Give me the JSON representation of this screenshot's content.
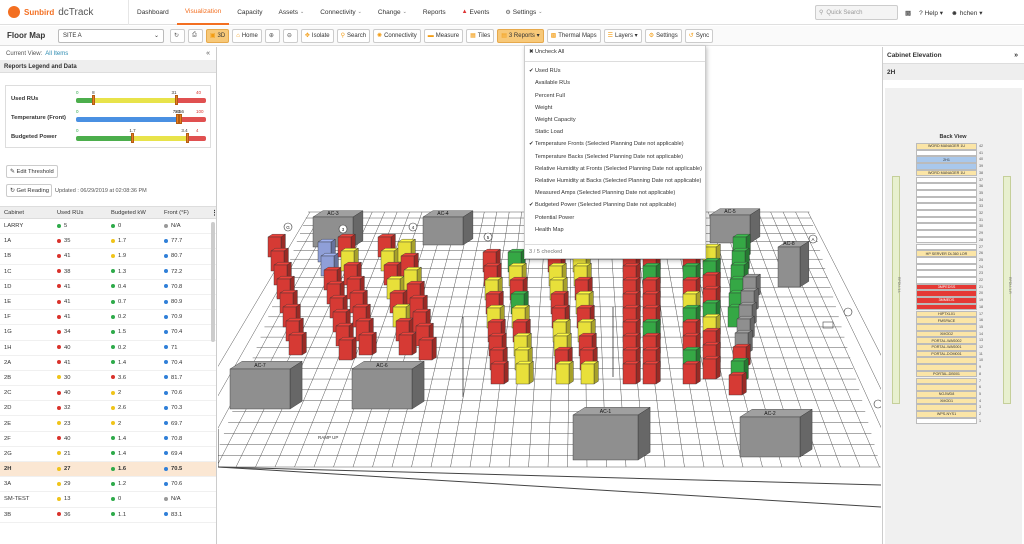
{
  "app": {
    "brand": "Sunbird",
    "product": "dcTrack",
    "nav": [
      {
        "label": "Dashboard",
        "caret": false,
        "active": false
      },
      {
        "label": "Visualization",
        "caret": false,
        "active": true
      },
      {
        "label": "Capacity",
        "caret": false,
        "active": false
      },
      {
        "label": "Assets",
        "caret": true,
        "active": false
      },
      {
        "label": "Connectivity",
        "caret": true,
        "active": false
      },
      {
        "label": "Change",
        "caret": true,
        "active": false
      },
      {
        "label": "Reports",
        "caret": false,
        "active": false
      },
      {
        "label": "Events",
        "caret": false,
        "active": false
      },
      {
        "label": "Settings",
        "caret": true,
        "active": false
      }
    ],
    "quick_search_placeholder": "Quick Search",
    "help_label": "Help",
    "user_label": "hchen"
  },
  "toolbar": {
    "title": "Floor Map",
    "site": "SITE A",
    "buttons": {
      "view3d": "3D",
      "home": "Home",
      "isolate": "Isolate",
      "search": "Search",
      "connectivity": "Connectivity",
      "measure": "Measure",
      "tiles": "Tiles",
      "reports": "3 Reports",
      "thermal": "Thermal Maps",
      "layers": "Layers",
      "settings": "Settings",
      "sync": "Sync"
    }
  },
  "left": {
    "current_view_label": "Current View:",
    "current_view_value": "All Items",
    "legend_title": "Reports Legend and Data",
    "legend": [
      {
        "label": "Used RUs",
        "nums": [
          "0",
          "8",
          "31",
          "40"
        ],
        "thumbs": [
          0.13,
          0.77
        ]
      },
      {
        "label": "Temperature (Front)",
        "nums": [
          "0",
          "72.5",
          "80.6",
          "100"
        ],
        "thumbs": [
          0.78,
          0.8
        ]
      },
      {
        "label": "Budgeted Power",
        "nums": [
          "0",
          "1.7",
          "3.4",
          "4"
        ],
        "thumbs": [
          0.43,
          0.85
        ]
      }
    ],
    "edit_threshold": "Edit Threshold",
    "get_reading": "Get Reading",
    "updated": "Updated : 06/29/2019 at 02:08:36 PM",
    "columns": [
      "Cabinet",
      "Used RUs",
      "Budgeted kW",
      "Front (°F)"
    ],
    "rows": [
      {
        "cab": "LARRY",
        "ru": "5",
        "ruc": "#2eaa4a",
        "kw": "0",
        "kwc": "#2eaa4a",
        "f": "N/A",
        "fc": "#999999",
        "hl": false
      },
      {
        "cab": "1A",
        "ru": "35",
        "ruc": "#d9322b",
        "kw": "1.7",
        "kwc": "#f0c419",
        "f": "77.7",
        "fc": "#2f7fd8",
        "hl": false
      },
      {
        "cab": "1B",
        "ru": "41",
        "ruc": "#d9322b",
        "kw": "1.9",
        "kwc": "#f0c419",
        "f": "80.7",
        "fc": "#2f7fd8",
        "hl": false
      },
      {
        "cab": "1C",
        "ru": "38",
        "ruc": "#d9322b",
        "kw": "1.3",
        "kwc": "#2eaa4a",
        "f": "72.2",
        "fc": "#2f7fd8",
        "hl": false
      },
      {
        "cab": "1D",
        "ru": "41",
        "ruc": "#d9322b",
        "kw": "0.4",
        "kwc": "#2eaa4a",
        "f": "70.8",
        "fc": "#2f7fd8",
        "hl": false
      },
      {
        "cab": "1E",
        "ru": "41",
        "ruc": "#d9322b",
        "kw": "0.7",
        "kwc": "#2eaa4a",
        "f": "80.9",
        "fc": "#2f7fd8",
        "hl": false
      },
      {
        "cab": "1F",
        "ru": "41",
        "ruc": "#d9322b",
        "kw": "0.2",
        "kwc": "#2eaa4a",
        "f": "70.9",
        "fc": "#2f7fd8",
        "hl": false
      },
      {
        "cab": "1G",
        "ru": "34",
        "ruc": "#d9322b",
        "kw": "1.5",
        "kwc": "#2eaa4a",
        "f": "70.4",
        "fc": "#2f7fd8",
        "hl": false
      },
      {
        "cab": "1H",
        "ru": "40",
        "ruc": "#d9322b",
        "kw": "0.2",
        "kwc": "#2eaa4a",
        "f": "71",
        "fc": "#2f7fd8",
        "hl": false
      },
      {
        "cab": "2A",
        "ru": "41",
        "ruc": "#d9322b",
        "kw": "1.4",
        "kwc": "#2eaa4a",
        "f": "70.4",
        "fc": "#2f7fd8",
        "hl": false
      },
      {
        "cab": "2B",
        "ru": "30",
        "ruc": "#f0c419",
        "kw": "3.6",
        "kwc": "#d9322b",
        "f": "81.7",
        "fc": "#2f7fd8",
        "hl": false
      },
      {
        "cab": "2C",
        "ru": "40",
        "ruc": "#d9322b",
        "kw": "2",
        "kwc": "#f0c419",
        "f": "70.6",
        "fc": "#2f7fd8",
        "hl": false
      },
      {
        "cab": "2D",
        "ru": "32",
        "ruc": "#d9322b",
        "kw": "2.6",
        "kwc": "#f0c419",
        "f": "70.3",
        "fc": "#2f7fd8",
        "hl": false
      },
      {
        "cab": "2E",
        "ru": "23",
        "ruc": "#f0c419",
        "kw": "2",
        "kwc": "#f0c419",
        "f": "69.7",
        "fc": "#2f7fd8",
        "hl": false
      },
      {
        "cab": "2F",
        "ru": "40",
        "ruc": "#d9322b",
        "kw": "1.4",
        "kwc": "#2eaa4a",
        "f": "70.8",
        "fc": "#2f7fd8",
        "hl": false
      },
      {
        "cab": "2G",
        "ru": "21",
        "ruc": "#f0c419",
        "kw": "1.4",
        "kwc": "#2eaa4a",
        "f": "69.4",
        "fc": "#2f7fd8",
        "hl": false
      },
      {
        "cab": "2H",
        "ru": "27",
        "ruc": "#f0c419",
        "kw": "1.6",
        "kwc": "#2eaa4a",
        "f": "70.5",
        "fc": "#2f7fd8",
        "hl": true
      },
      {
        "cab": "3A",
        "ru": "29",
        "ruc": "#f0c419",
        "kw": "1.2",
        "kwc": "#2eaa4a",
        "f": "70.6",
        "fc": "#2f7fd8",
        "hl": false
      },
      {
        "cab": "SM-TEST",
        "ru": "13",
        "ruc": "#f0c419",
        "kw": "0",
        "kwc": "#2eaa4a",
        "f": "N/A",
        "fc": "#999999",
        "hl": false
      },
      {
        "cab": "3B",
        "ru": "36",
        "ruc": "#d9322b",
        "kw": "1.1",
        "kwc": "#2eaa4a",
        "f": "83.1",
        "fc": "#2f7fd8",
        "hl": false
      }
    ]
  },
  "dropdown": {
    "uncheck_all": "Uncheck All",
    "items": [
      {
        "label": "Used RUs",
        "checked": true
      },
      {
        "label": "Available RUs",
        "checked": false
      },
      {
        "label": "Percent Full",
        "checked": false
      },
      {
        "label": "Weight",
        "checked": false
      },
      {
        "label": "Weight Capacity",
        "checked": false
      },
      {
        "label": "Static Load",
        "checked": false
      },
      {
        "label": "Temperature Fronts (Selected Planning Date not applicable)",
        "checked": true
      },
      {
        "label": "Temperature Backs (Selected Planning Date not applicable)",
        "checked": false
      },
      {
        "label": "Relative Humidity at Fronts (Selected Planning Date not applicable)",
        "checked": false
      },
      {
        "label": "Relative Humidity at Backs (Selected Planning Date not applicable)",
        "checked": false
      },
      {
        "label": "Measured Amps (Selected Planning Date not applicable)",
        "checked": false
      },
      {
        "label": "Budgeted Power (Selected Planning Date not applicable)",
        "checked": true
      },
      {
        "label": "Potential Power",
        "checked": false
      },
      {
        "label": "Health Map",
        "checked": false
      }
    ],
    "footer": "3 / 5 checked"
  },
  "right": {
    "title": "Cabinet Elevation",
    "cabinet": "2H",
    "back_view": "Back View",
    "rail_left": "RPDU-1-L",
    "rail_right": "RPDU-1-R",
    "units": [
      {
        "u": "42",
        "label": "WORD MANAGER 1U",
        "color": "#fbe5a6"
      },
      {
        "u": "41",
        "label": "",
        "color": "#ffffff"
      },
      {
        "u": "40",
        "label": "2H1",
        "color": "#a9c8ec"
      },
      {
        "u": "39",
        "label": "",
        "color": "#a9c8ec"
      },
      {
        "u": "38",
        "label": "WORD MANAGER 1U",
        "color": "#fbe5a6"
      },
      {
        "u": "37",
        "label": "",
        "color": "#ffffff"
      },
      {
        "u": "36",
        "label": "",
        "color": "#ffffff"
      },
      {
        "u": "35",
        "label": "",
        "color": "#ffffff"
      },
      {
        "u": "34",
        "label": "",
        "color": "#ffffff"
      },
      {
        "u": "33",
        "label": "",
        "color": "#ffffff"
      },
      {
        "u": "32",
        "label": "",
        "color": "#ffffff"
      },
      {
        "u": "31",
        "label": "",
        "color": "#ffffff"
      },
      {
        "u": "30",
        "label": "",
        "color": "#ffffff"
      },
      {
        "u": "29",
        "label": "",
        "color": "#ffffff"
      },
      {
        "u": "28",
        "label": "",
        "color": "#ffffff"
      },
      {
        "u": "27",
        "label": "",
        "color": "#ffffff"
      },
      {
        "u": "26",
        "label": "HP SERVER DL360 LOR",
        "color": "#fbe5a6"
      },
      {
        "u": "25",
        "label": "",
        "color": "#ffffff"
      },
      {
        "u": "24",
        "label": "",
        "color": "#ffffff"
      },
      {
        "u": "23",
        "label": "",
        "color": "#ffffff"
      },
      {
        "u": "22",
        "label": "",
        "color": "#ffffff"
      },
      {
        "u": "21",
        "label": "3MPEDSS",
        "color": "#e53935"
      },
      {
        "u": "20",
        "label": "",
        "color": "#e53935"
      },
      {
        "u": "19",
        "label": "3MMEDS",
        "color": "#e53935"
      },
      {
        "u": "18",
        "label": "",
        "color": "#e53935"
      },
      {
        "u": "17",
        "label": "HIPTXL01",
        "color": "#fbe5a6"
      },
      {
        "u": "16",
        "label": "FMSPACE",
        "color": "#fbe5a6"
      },
      {
        "u": "15",
        "label": "",
        "color": "#fbe5a6"
      },
      {
        "u": "14",
        "label": "XMOD2",
        "color": "#fbe5a6"
      },
      {
        "u": "13",
        "label": "PORTAL-WAS002",
        "color": "#fbe5a6"
      },
      {
        "u": "12",
        "label": "PORTAL-WAS001",
        "color": "#fbe5a6"
      },
      {
        "u": "11",
        "label": "PORTAL-DOM001",
        "color": "#fbe5a6"
      },
      {
        "u": "10",
        "label": "",
        "color": "#fbe5a6"
      },
      {
        "u": "9",
        "label": "",
        "color": "#fbe5a6"
      },
      {
        "u": "8",
        "label": "PORTAL-DB001",
        "color": "#fbe5a6"
      },
      {
        "u": "7",
        "label": "",
        "color": "#fbe5a6"
      },
      {
        "u": "6",
        "label": "",
        "color": "#fbe5a6"
      },
      {
        "u": "5",
        "label": "NOJWD8",
        "color": "#fbe5a6"
      },
      {
        "u": "4",
        "label": "XMOD1",
        "color": "#fbe5a6"
      },
      {
        "u": "3",
        "label": "",
        "color": "#fbe5a6"
      },
      {
        "u": "2",
        "label": "WPS-NYS1",
        "color": "#fbe5a6"
      },
      {
        "u": "1",
        "label": "",
        "color": "#ffffff"
      }
    ]
  },
  "floor": {
    "ac_units": [
      {
        "id": "ac7",
        "label": "AC-7"
      },
      {
        "id": "ac6",
        "label": "AC-6"
      },
      {
        "id": "ac1",
        "label": "AC-1"
      },
      {
        "id": "ac2",
        "label": "AC-2"
      },
      {
        "id": "ac3",
        "label": "AC-3"
      },
      {
        "id": "ac4",
        "label": "AC-4"
      },
      {
        "id": "ac5",
        "label": "AC-5"
      },
      {
        "id": "ac8",
        "label": "AC-8"
      }
    ],
    "row_markers": [
      "G",
      "3",
      "4",
      "5",
      "6",
      "7",
      "8",
      "A"
    ],
    "ramp_label": "RAMP UP",
    "colors": {
      "red": "#d63a34",
      "yellow": "#e8e03a",
      "green": "#35a845",
      "gray": "#8f8f8f",
      "blue": "#8f9fd8"
    }
  }
}
